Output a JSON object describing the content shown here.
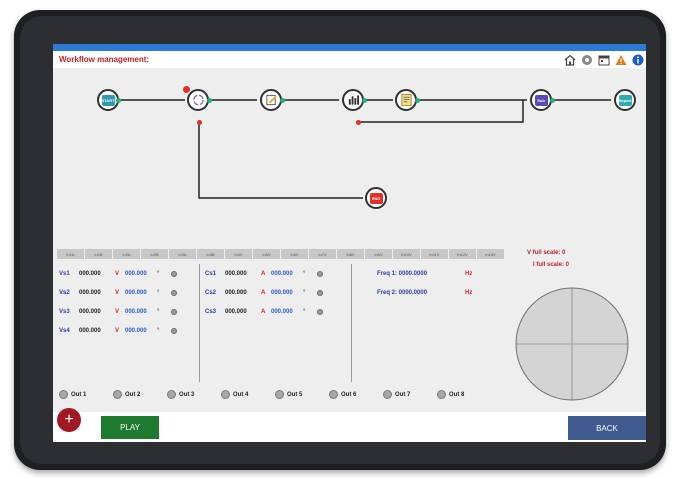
{
  "header": {
    "title": "Workflow management:",
    "icons": [
      "home-icon",
      "settings-icon",
      "calendar-icon",
      "warning-icon",
      "info-icon"
    ]
  },
  "colors": {
    "accent_blue": "#2a7ad6",
    "title_red": "#c0202a",
    "play_green": "#1e7a2e",
    "back_blue": "#3e5a8e",
    "connector_green": "#1fb27a",
    "connector_red": "#e0302a"
  },
  "workflow": {
    "nodes": [
      {
        "icon": "start-icon",
        "glyph": "START",
        "color": "#2e9ab0"
      },
      {
        "icon": "cycle-icon",
        "glyph": "",
        "color": "#7a6cc8"
      },
      {
        "icon": "edit-icon",
        "glyph": "",
        "color": "#e6a83a"
      },
      {
        "icon": "bar-chart-icon",
        "glyph": "",
        "color": "#303030"
      },
      {
        "icon": "report-icon",
        "glyph": "",
        "color": "#d9a63a"
      },
      {
        "icon": "sub-icon",
        "glyph": "Sub",
        "color": "#5a4ab8"
      },
      {
        "icon": "report-end-icon",
        "glyph": "Report",
        "color": "#2eaab0"
      },
      {
        "icon": "end-icon",
        "glyph": "END",
        "color": "#e0302a"
      }
    ]
  },
  "channels": {
    "tabs": [
      "In1A",
      "In1B",
      "In2A",
      "In2B",
      "In3A",
      "In3B",
      "In4V",
      "In5V",
      "In6V",
      "In7V",
      "In8V",
      "In9V",
      "In10V",
      "In11V",
      "In12V",
      "In13V"
    ],
    "voltages": [
      {
        "label": "Vs1",
        "value": "000.000",
        "unit": "V",
        "angle": "000.000",
        "deg": "°"
      },
      {
        "label": "Vs2",
        "value": "000.000",
        "unit": "V",
        "angle": "000.000",
        "deg": "°"
      },
      {
        "label": "Vs3",
        "value": "000.000",
        "unit": "V",
        "angle": "000.000",
        "deg": "°"
      },
      {
        "label": "Vs4",
        "value": "000.000",
        "unit": "V",
        "angle": "000.000",
        "deg": "°"
      }
    ],
    "currents": [
      {
        "label": "Cs1",
        "value": "000.000",
        "unit": "A",
        "angle": "000.000",
        "deg": "°"
      },
      {
        "label": "Cs2",
        "value": "000.000",
        "unit": "A",
        "angle": "000.000",
        "deg": "°"
      },
      {
        "label": "Cs3",
        "value": "000.000",
        "unit": "A",
        "angle": "000.000",
        "deg": "°"
      }
    ],
    "freqs": [
      {
        "label": "Freq 1: 0000.0000",
        "unit": "Hz"
      },
      {
        "label": "Freq 2: 0000.0000",
        "unit": "Hz"
      }
    ],
    "v_full_scale": "V full scale: 0",
    "i_full_scale": "I full scale: 0",
    "outs": [
      "Out 1",
      "Out 2",
      "Out 3",
      "Out 4",
      "Out 5",
      "Out 6",
      "Out 7",
      "Out 8"
    ]
  },
  "footer": {
    "add_label": "+",
    "play_label": "PLAY",
    "back_label": "BACK"
  }
}
